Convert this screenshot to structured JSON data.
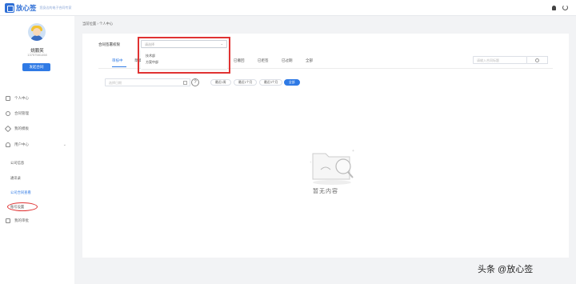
{
  "header": {
    "brand_name": "放心签",
    "brand_slogan": "您身边的电子合同专家"
  },
  "sidebar": {
    "user_name": "姚鹏笑",
    "user_phone": "13757581458",
    "launch_button": "发起合同",
    "items": [
      {
        "label": "个人中心"
      },
      {
        "label": "合同管理"
      },
      {
        "label": "我的模板"
      },
      {
        "label": "用户中心",
        "expanded": true
      },
      {
        "label": "我的审批"
      }
    ],
    "sub_items": [
      {
        "label": "公司信息"
      },
      {
        "label": "通讯录"
      },
      {
        "label": "公司合同查看"
      },
      {
        "label": "账号设置"
      }
    ]
  },
  "breadcrumb": {
    "prefix": "当前位置",
    "separator": "›",
    "current": "个人中心"
  },
  "filter": {
    "label": "合同签署权限",
    "select_placeholder": "请选择",
    "options": [
      "技术部",
      "方案中部"
    ]
  },
  "tabs": [
    "审核中",
    "草稿",
    "已撤回",
    "已拒签",
    "已过期",
    "全部"
  ],
  "active_tab": "审核中",
  "search": {
    "placeholder": "请输入合同标题"
  },
  "date": {
    "placeholder": "选择日期"
  },
  "time_filters": [
    "最近1周",
    "最近1个月",
    "最近3个月",
    "全部"
  ],
  "active_time_filter": "全部",
  "empty": {
    "text": "暂无内容"
  },
  "watermark": "头条 @放心签",
  "colors": {
    "accent": "#2f7ae5",
    "highlight": "#e03232"
  }
}
